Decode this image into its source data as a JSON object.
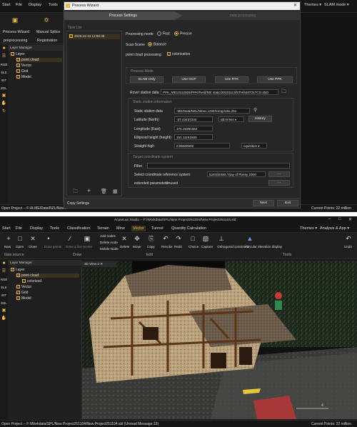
{
  "top": {
    "menu": [
      "Start",
      "File",
      "Display",
      "Tools"
    ],
    "menu_right": [
      "Themes ▾",
      "SLAM mode ▾"
    ],
    "ribbon_buttons": [
      "Process Wizard",
      "Manual Splice"
    ],
    "ribbon_tabs": [
      "preprocessing",
      "Registration"
    ],
    "layer_manager": "Layer Manager",
    "tree": {
      "root": "Layer",
      "items": [
        "point cloud",
        "Vector",
        "Grid",
        "Model"
      ]
    },
    "side_labels": [
      "RGB",
      "ELE",
      "INT",
      "EDL"
    ],
    "status_left": "Open Project -- F:/A-ME/Data/NZL/New...",
    "status_right": "Current Points: 22 million"
  },
  "dialog": {
    "title": "Process Wizard",
    "steps": [
      "Process Settings",
      "data processing"
    ],
    "task_list_label": "Task List",
    "task_item": "2025-11-13 12:50:38",
    "processing_mode_label": "Processing mode",
    "mode_options": [
      "Fast",
      "Precise"
    ],
    "scan_scene_label": "Scan Scene",
    "scan_scene_value": "Balance",
    "pc_processing_label": "point cloud processing",
    "colorization_label": "colorization",
    "process_mode_heading": "Process Mode",
    "process_modes": [
      "SLAM Only",
      "Use GCP",
      "Use RTK",
      "Use PPK"
    ],
    "rover_label": "Rover station data",
    "rover_value": "PPK_ME13112025/PPK/Field/ME static/20231113/STH/6407317CO.25O",
    "static_heading": "Static station information",
    "static_data_label": "Static station data",
    "static_data_value": "-ME/Data/NZL/Ninex LINZ/rnmg316x.25o",
    "latitude_label": "Latitude (North)",
    "latitude_value": "-37.43437234",
    "latitude_unit": "dd.mmss ▾",
    "history_button": "History",
    "longitude_label": "Longitude (East)",
    "longitude_value": "176.15391582",
    "ellipsoid_label": "Ellipsoid height (height)",
    "ellipsoid_value": "151.11161500",
    "straight_label": "Straight high",
    "straight_value": "0.05500000",
    "straight_unit": "cquisition ▾",
    "target_heading": "Target coordinate system",
    "filter_label": "Filter",
    "select_crs_label": "Select coordinate reference system",
    "select_crs_value": "NZGD2000 / Bay of Plenty 2000",
    "ellipsis": "...",
    "extended_label": "extended parameters",
    "extended_value": "Unused",
    "copy_settings": "Copy Settings",
    "next": "Next",
    "exit": "Exit"
  },
  "bottom": {
    "title": "AcuteLas Studio -- F:/Workdata/SPL/New Project251104/New Project251104.sld",
    "menu": [
      "Start",
      "File",
      "Display",
      "Tools",
      "Classification",
      "Terrain",
      "Mine",
      "Vector",
      "Tunnel",
      "Quantity Calculation"
    ],
    "menu_right": [
      "Themes ▾",
      "Analysis & App ▾"
    ],
    "tools": [
      "New",
      "Open",
      "Close",
      "Draw points",
      "Draw a line",
      "Scene",
      "Add nodes",
      "Delete node",
      "Mobile Node",
      "Delete",
      "Move",
      "Copy",
      "Revoke",
      "Redo",
      "Choice",
      "Capture",
      "Orthogonal constraint",
      "Circular elevation display",
      "Undo"
    ],
    "groups": [
      "data source",
      "Draw",
      "Edit",
      "Tools"
    ],
    "layer_manager": "Layer Manager",
    "view_tab": "3D View-2",
    "tree": {
      "root": "Layer",
      "items": [
        "point cloud",
        "colorized",
        "Vector",
        "Grid",
        "Model"
      ]
    },
    "side_labels": [
      "RGB",
      "ELE",
      "INT",
      "EDL"
    ],
    "scale": "4",
    "status_left": "Open Project -- F:/Workdata/SPL/New Project251104/New Project251104.sld (Unread Message:19)",
    "status_right": "Current Points: 22 million"
  },
  "colors": {
    "accent": "#e8b84a",
    "panel": "#1f1f1f",
    "selection": "#3a3220"
  }
}
